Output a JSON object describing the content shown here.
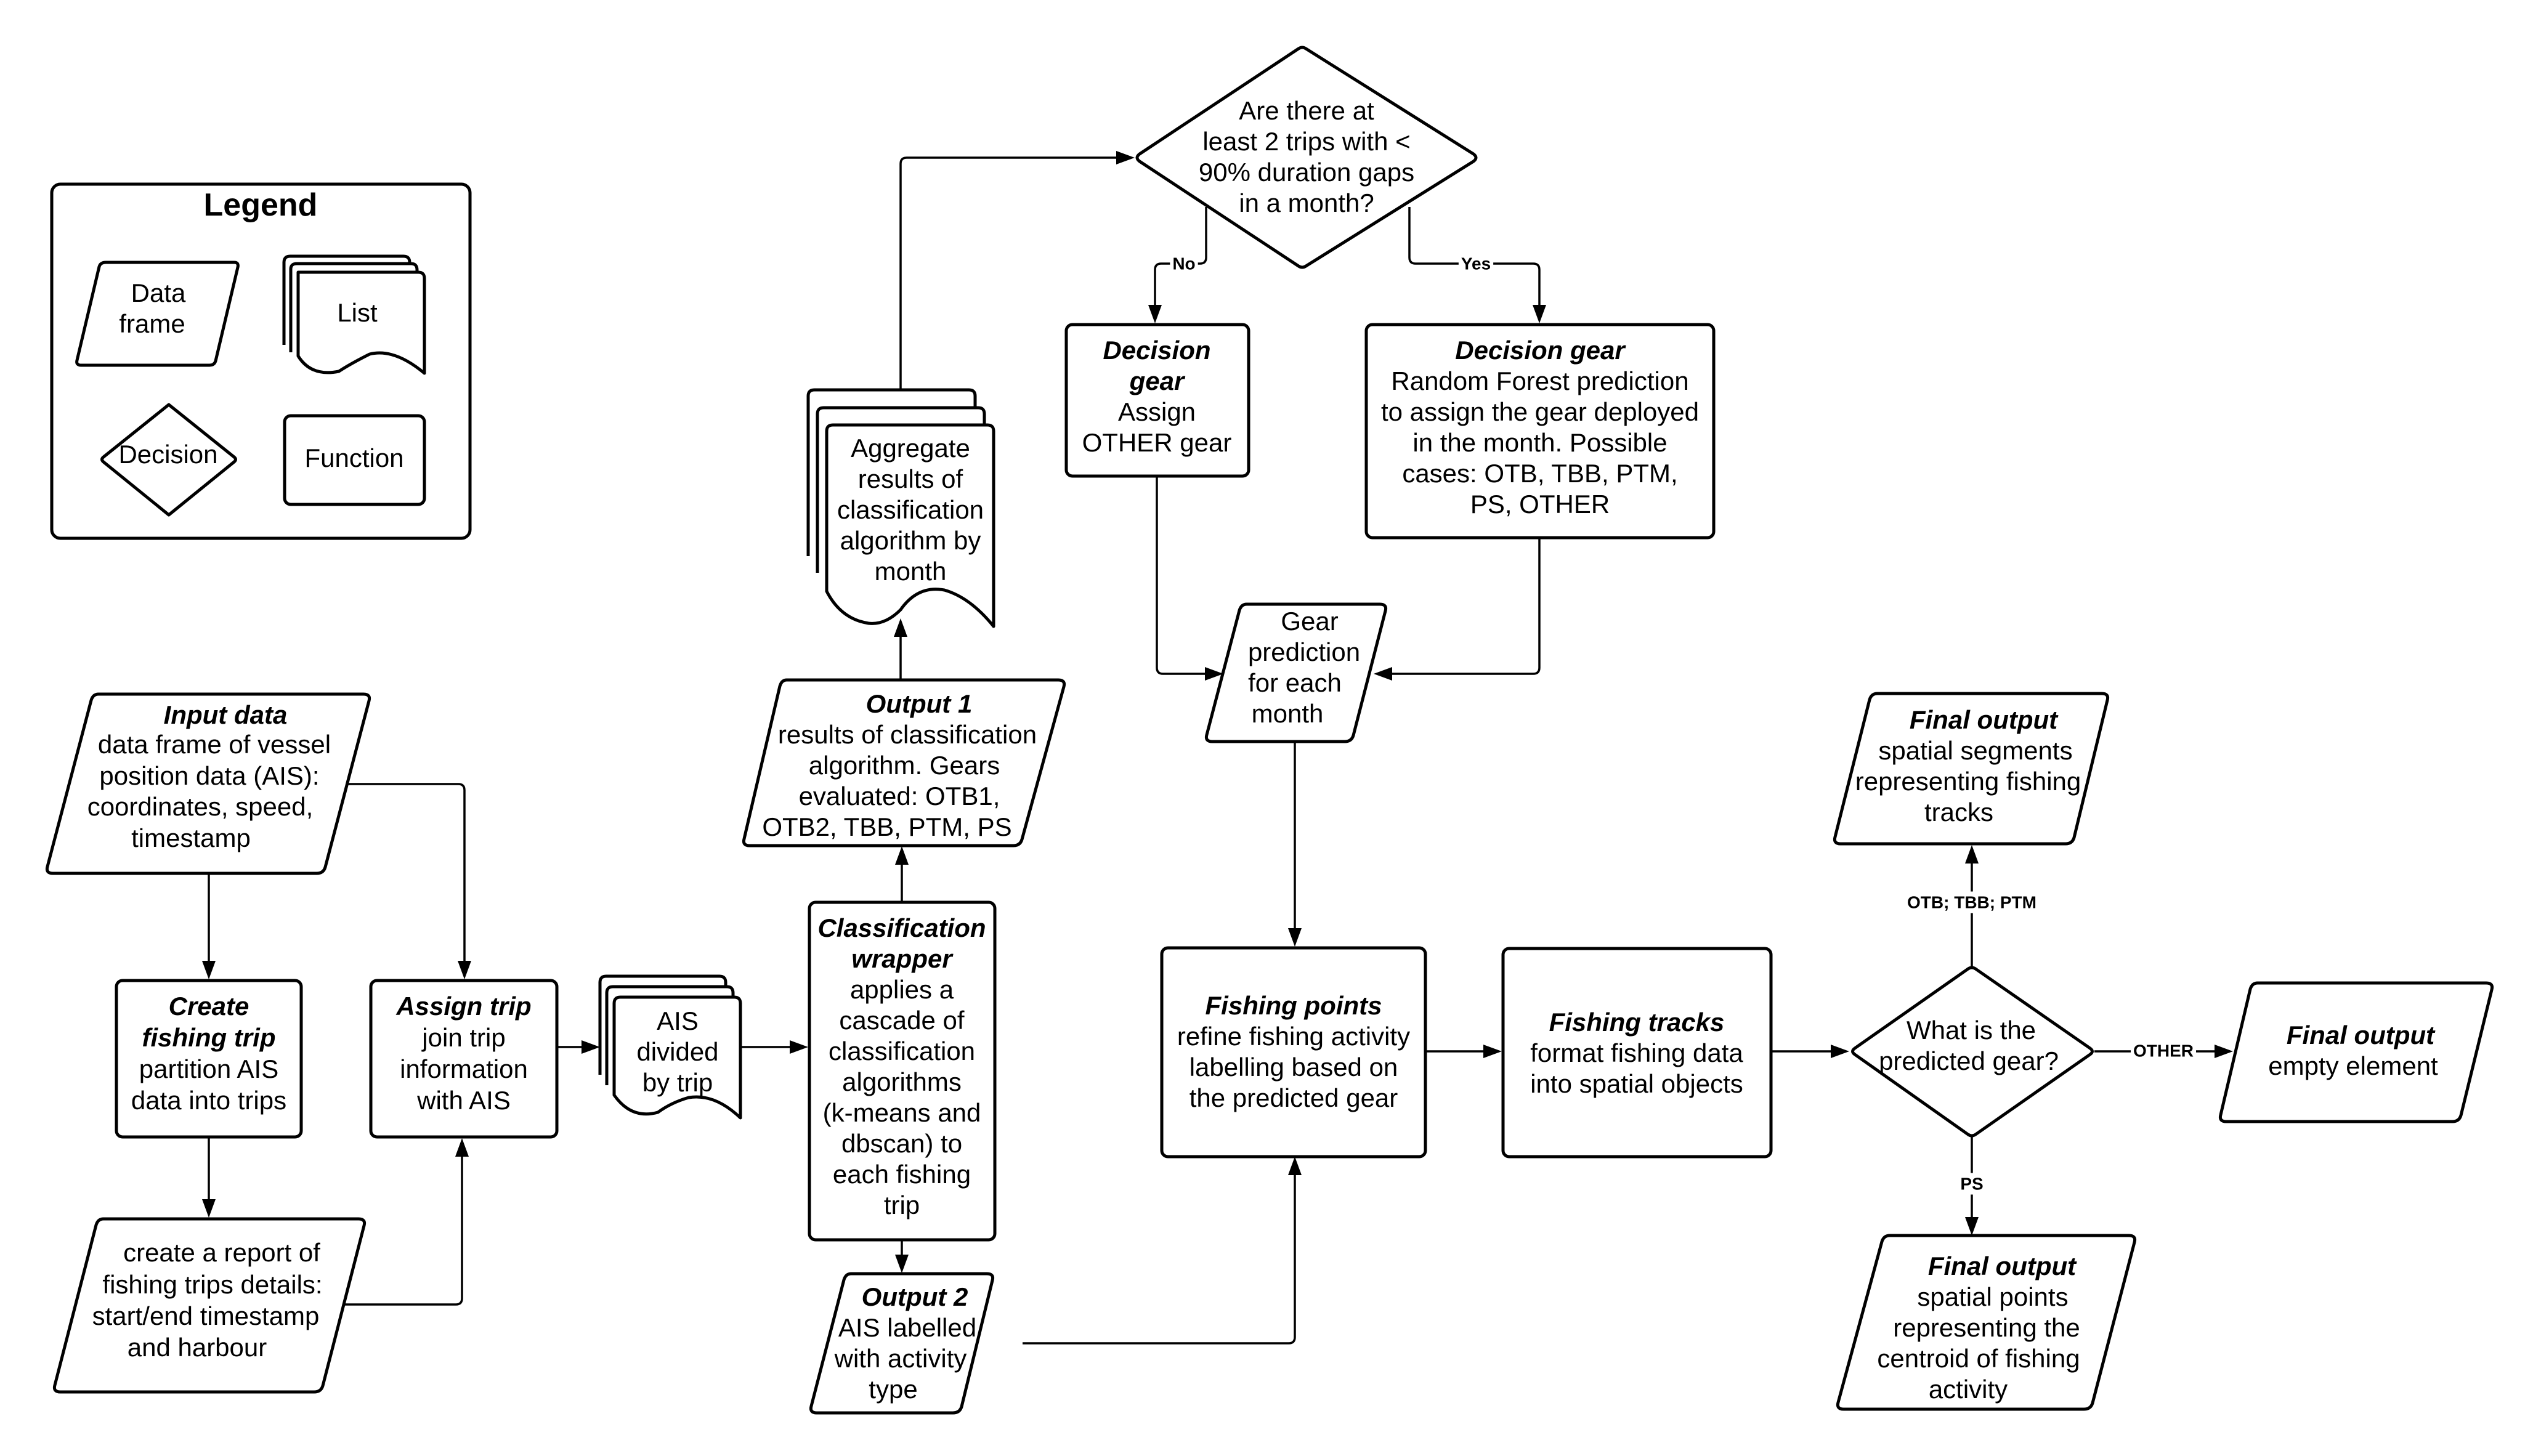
{
  "legend": {
    "title": "Legend",
    "items": {
      "data_frame": [
        "Data",
        "frame"
      ],
      "list": [
        "List"
      ],
      "decision": [
        "Decision"
      ],
      "function": [
        "Function"
      ]
    }
  },
  "nodes": {
    "input_data": {
      "type": "data-frame",
      "title": "Input data",
      "lines": [
        "data frame of vessel",
        "position data (AIS):",
        "coordinates, speed,",
        "timestamp"
      ]
    },
    "create_trip": {
      "type": "function",
      "title_lines": [
        "Create",
        "fishing trip"
      ],
      "lines": [
        "partition AIS",
        "data into trips"
      ]
    },
    "report": {
      "type": "data-frame",
      "lines": [
        "create a report of",
        "fishing trips details:",
        "start/end timestamp",
        "and harbour"
      ]
    },
    "assign_trip": {
      "type": "function",
      "title_lines": [
        "Assign trip"
      ],
      "lines": [
        "join trip",
        "information",
        "with AIS"
      ]
    },
    "ais_divided": {
      "type": "list",
      "lines": [
        "AIS",
        "divided",
        "by trip"
      ]
    },
    "classification": {
      "type": "function",
      "title_lines": [
        "Classification",
        "wrapper"
      ],
      "lines": [
        "applies a",
        "cascade of",
        "classification",
        "algorithms",
        "(k-means and",
        "dbscan) to",
        "each fishing",
        "trip"
      ]
    },
    "output1": {
      "type": "data-frame",
      "title": "Output 1",
      "lines": [
        "results of classification",
        "algorithm. Gears",
        "evaluated: OTB1,",
        "OTB2, TBB, PTM, PS"
      ]
    },
    "output2": {
      "type": "data-frame",
      "title": "Output 2",
      "lines": [
        "AIS labelled",
        "with activity",
        "type"
      ]
    },
    "aggregate": {
      "type": "list",
      "lines": [
        "Aggregate",
        "results of",
        "classification",
        "algorithm by",
        "month"
      ]
    },
    "decision_trips": {
      "type": "decision",
      "lines": [
        "Are there at",
        "least 2 trips with <",
        "90% duration gaps",
        "in a month?"
      ]
    },
    "decision_gear_other": {
      "type": "function",
      "title_lines": [
        "Decision",
        "gear"
      ],
      "lines": [
        "Assign",
        "OTHER gear"
      ]
    },
    "decision_gear_rf": {
      "type": "function",
      "title_lines": [
        "Decision gear"
      ],
      "lines": [
        "Random Forest prediction",
        "to assign the gear deployed",
        "in the month. Possible",
        "cases: OTB, TBB, PTM,",
        "PS, OTHER"
      ]
    },
    "gear_prediction": {
      "type": "data-frame",
      "lines": [
        "Gear",
        "prediction",
        "for each",
        "month"
      ]
    },
    "fishing_points": {
      "type": "function",
      "title_lines": [
        "Fishing points"
      ],
      "lines": [
        "refine fishing activity",
        "labelling based on",
        "the predicted gear"
      ]
    },
    "fishing_tracks": {
      "type": "function",
      "title_lines": [
        "Fishing tracks"
      ],
      "lines": [
        "format fishing data",
        "into spatial objects"
      ]
    },
    "decision_predicted_gear": {
      "type": "decision",
      "lines": [
        "What is the",
        "predicted gear?"
      ]
    },
    "final_tracks": {
      "type": "data-frame",
      "title": "Final output",
      "lines": [
        "spatial segments",
        "representing fishing",
        "tracks"
      ]
    },
    "final_empty": {
      "type": "data-frame",
      "title": "Final output",
      "lines": [
        "empty element"
      ]
    },
    "final_points": {
      "type": "data-frame",
      "title": "Final output",
      "lines": [
        "spatial points",
        "representing the",
        "centroid of fishing",
        "activity"
      ]
    }
  },
  "edge_labels": {
    "no": "No",
    "yes": "Yes",
    "otb_tbb_ptm": "OTB; TBB; PTM",
    "other": "OTHER",
    "ps": "PS"
  }
}
